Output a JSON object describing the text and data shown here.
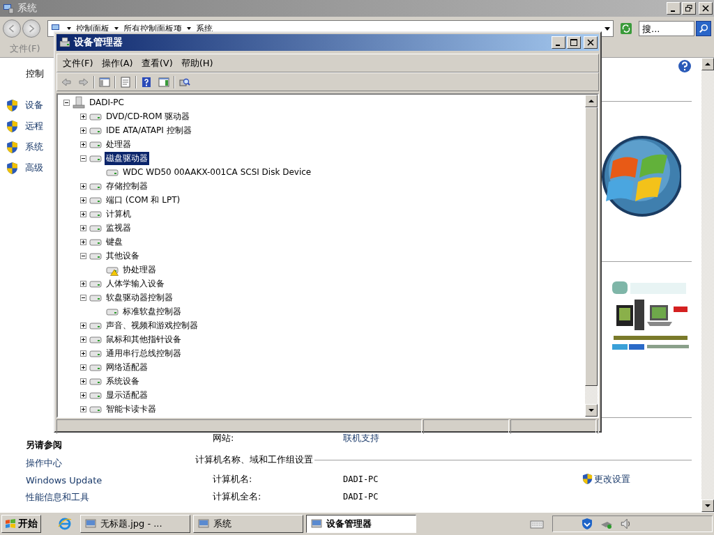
{
  "system_window": {
    "title": "系统",
    "address": [
      "控制面板",
      "所有控制面板项",
      "系统"
    ],
    "search": {
      "placeholder": "搜..."
    },
    "menu": [
      "文件(F)"
    ],
    "left_header": "控制",
    "tasks": [
      "设备",
      "远程",
      "系统",
      "高级"
    ],
    "see_also": {
      "title": "另请参阅",
      "links": [
        "操作中心",
        "Windows Update",
        "性能信息和工具"
      ]
    },
    "website": {
      "label": "网站:",
      "value": "联机支持"
    },
    "computer_section": {
      "title": "计算机名称、域和工作组设置",
      "action": "更改设置",
      "rows": [
        {
          "label": "计算机名:",
          "value": "DADI-PC"
        },
        {
          "label": "计算机全名:",
          "value": "DADI-PC"
        }
      ]
    }
  },
  "device_manager": {
    "title": "设备管理器",
    "menu": [
      "文件(F)",
      "操作(A)",
      "查看(V)",
      "帮助(H)"
    ],
    "tree": {
      "label": "DADI-PC",
      "expanded": true,
      "selected": false,
      "warning": false,
      "children": [
        {
          "label": "DVD/CD-ROM 驱动器",
          "expanded": false,
          "selected": false,
          "warning": false
        },
        {
          "label": "IDE ATA/ATAPI 控制器",
          "expanded": false,
          "selected": false,
          "warning": false
        },
        {
          "label": "处理器",
          "expanded": false,
          "selected": false,
          "warning": false
        },
        {
          "label": "磁盘驱动器",
          "expanded": true,
          "selected": true,
          "warning": false,
          "children": [
            {
              "label": "WDC WD50 00AAKX-001CA SCSI Disk Device",
              "selected": false,
              "warning": false
            }
          ]
        },
        {
          "label": "存储控制器",
          "expanded": false,
          "selected": false,
          "warning": false
        },
        {
          "label": "端口 (COM 和 LPT)",
          "expanded": false,
          "selected": false,
          "warning": false
        },
        {
          "label": "计算机",
          "expanded": false,
          "selected": false,
          "warning": false
        },
        {
          "label": "监视器",
          "expanded": false,
          "selected": false,
          "warning": false
        },
        {
          "label": "键盘",
          "expanded": false,
          "selected": false,
          "warning": false
        },
        {
          "label": "其他设备",
          "expanded": true,
          "selected": false,
          "warning": false,
          "children": [
            {
              "label": "协处理器",
              "selected": false,
              "warning": true
            }
          ]
        },
        {
          "label": "人体学输入设备",
          "expanded": false,
          "selected": false,
          "warning": false
        },
        {
          "label": "软盘驱动器控制器",
          "expanded": true,
          "selected": false,
          "warning": false,
          "children": [
            {
              "label": "标准软盘控制器",
              "selected": false,
              "warning": false
            }
          ]
        },
        {
          "label": "声音、视频和游戏控制器",
          "expanded": false,
          "selected": false,
          "warning": false
        },
        {
          "label": "鼠标和其他指针设备",
          "expanded": false,
          "selected": false,
          "warning": false
        },
        {
          "label": "通用串行总线控制器",
          "expanded": false,
          "selected": false,
          "warning": false
        },
        {
          "label": "网络适配器",
          "expanded": false,
          "selected": false,
          "warning": false
        },
        {
          "label": "系统设备",
          "expanded": false,
          "selected": false,
          "warning": false
        },
        {
          "label": "显示适配器",
          "expanded": false,
          "selected": false,
          "warning": false
        },
        {
          "label": "智能卡读卡器",
          "expanded": false,
          "selected": false,
          "warning": false
        }
      ]
    }
  },
  "taskbar": {
    "start": "开始",
    "tasks": [
      {
        "label": "无标题.jpg - ...",
        "selected": false
      },
      {
        "label": "系统",
        "selected": false
      },
      {
        "label": "设备管理器",
        "selected": true
      }
    ]
  }
}
